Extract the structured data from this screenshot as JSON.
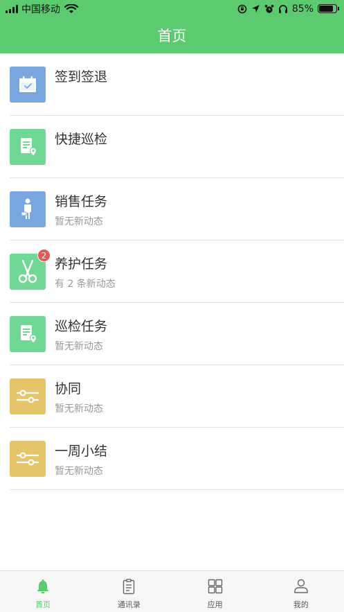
{
  "status_bar": {
    "carrier": "中国移动",
    "battery": "85%",
    "battery_level": 0.85
  },
  "header": {
    "title": "首页"
  },
  "colors": {
    "brand_green": "#5ccb70",
    "icon_blue": "#7aa6e0",
    "icon_green": "#6fd895",
    "icon_yellow": "#e6c46a",
    "badge_red": "#e05a4f"
  },
  "list": {
    "items": [
      {
        "title": "签到签退",
        "subtitle": "",
        "icon": "calendar-check-icon"
      },
      {
        "title": "快捷巡检",
        "subtitle": "",
        "icon": "document-location-icon"
      },
      {
        "title": "销售任务",
        "subtitle": "暂无新动态",
        "icon": "salesperson-icon"
      },
      {
        "title": "养护任务",
        "subtitle": "有 2 条新动态",
        "icon": "scissors-icon",
        "badge": "2"
      },
      {
        "title": "巡检任务",
        "subtitle": "暂无新动态",
        "icon": "document-location-icon"
      },
      {
        "title": "协同",
        "subtitle": "暂无新动态",
        "icon": "sliders-icon"
      },
      {
        "title": "一周小结",
        "subtitle": "暂无新动态",
        "icon": "sliders-icon"
      }
    ]
  },
  "tabbar": {
    "tabs": [
      {
        "label": "首页",
        "icon": "bell-icon",
        "active": true
      },
      {
        "label": "通讯录",
        "icon": "clipboard-icon",
        "active": false
      },
      {
        "label": "应用",
        "icon": "grid-icon",
        "active": false
      },
      {
        "label": "我的",
        "icon": "person-icon",
        "active": false
      }
    ]
  }
}
